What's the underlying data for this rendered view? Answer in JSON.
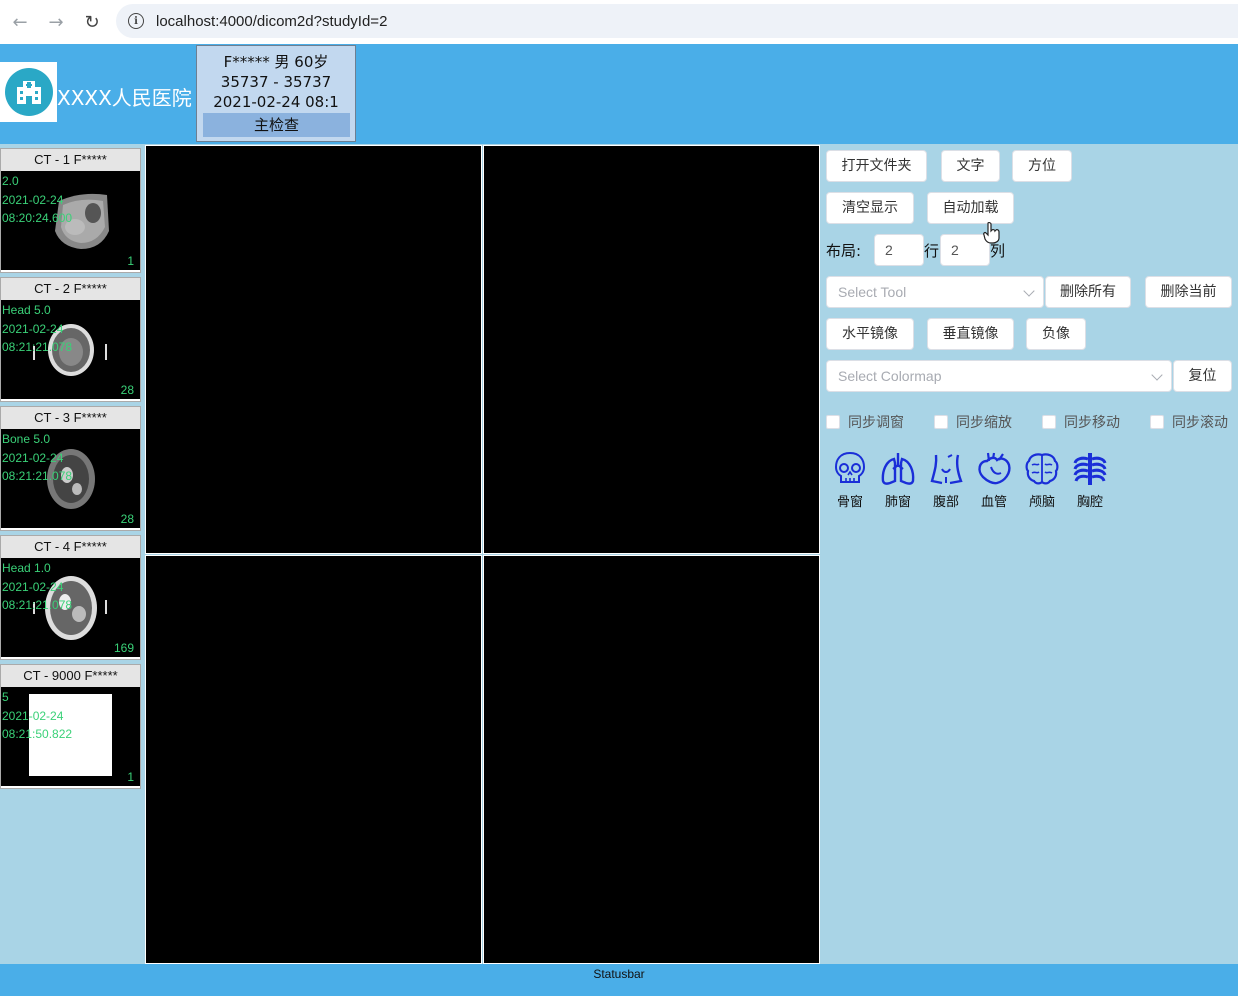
{
  "browser": {
    "url": "localhost:4000/dicom2d?studyId=2"
  },
  "header": {
    "hospital_name": "XXXX人民医院",
    "patient": {
      "line1": "F***** 男   60岁",
      "line2": "35737  -  35737",
      "line3": "2021-02-24 08:1",
      "tab_label": "主检查"
    }
  },
  "series": [
    {
      "title": "CT - 1 F*****",
      "desc": "2.0",
      "date": "2021-02-24",
      "time": "08:20:24.600",
      "count": "1"
    },
    {
      "title": "CT - 2 F*****",
      "desc": "Head 5.0",
      "date": "2021-02-24",
      "time": "08:21:21.078",
      "count": "28"
    },
    {
      "title": "CT - 3 F*****",
      "desc": "Bone 5.0",
      "date": "2021-02-24",
      "time": "08:21:21.078",
      "count": "28"
    },
    {
      "title": "CT - 4 F*****",
      "desc": "Head 1.0",
      "date": "2021-02-24",
      "time": "08:21:21.078",
      "count": "169"
    },
    {
      "title": "CT - 9000 F*****",
      "desc": "5",
      "date": "2021-02-24",
      "time": "08:21:50.822",
      "count": "1"
    }
  ],
  "controls": {
    "open_folder": "打开文件夹",
    "text": "文字",
    "orientation": "方位",
    "clear_display": "清空显示",
    "auto_load": "自动加载",
    "layout_label": "布局:",
    "rows_value": "2",
    "rows_label": "行",
    "cols_value": "2",
    "cols_label": "列",
    "tool_placeholder": "Select Tool",
    "delete_all": "删除所有",
    "delete_current": "删除当前",
    "flip_h": "水平镜像",
    "flip_v": "垂直镜像",
    "invert": "负像",
    "colormap_placeholder": "Select Colormap",
    "reset": "复位",
    "sync_window": "同步调窗",
    "sync_zoom": "同步缩放",
    "sync_pan": "同步移动",
    "sync_scroll": "同步滚动",
    "presets": [
      "骨窗",
      "肺窗",
      "腹部",
      "血管",
      "颅脑",
      "胸腔"
    ]
  },
  "icons": {
    "presets": [
      "skull-icon",
      "lungs-icon",
      "abdomen-icon",
      "heart-icon",
      "brain-icon",
      "ribcage-icon"
    ],
    "preset_color": "#1a2ed8"
  },
  "statusbar": "Statusbar",
  "colors": {
    "header_bg": "#4aaee8",
    "panel_bg": "#a9d4e6",
    "overlay_text": "#3ad178"
  }
}
